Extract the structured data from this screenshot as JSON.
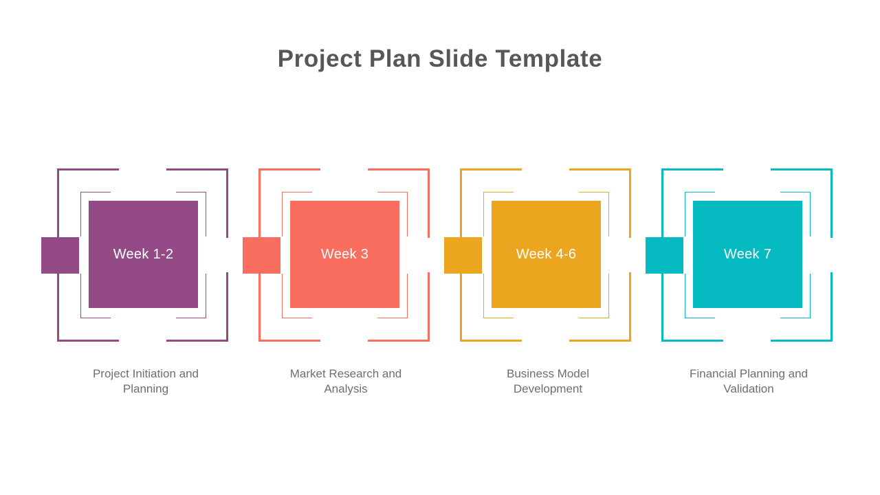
{
  "slide": {
    "title": "Project Plan Slide Template",
    "background_color": "#ffffff",
    "title_color": "#575757",
    "caption_color": "#6e6e6e"
  },
  "steps": [
    {
      "week_label": "Week 1-2",
      "caption": "Project Initiation and\nPlanning",
      "color": "#954a88"
    },
    {
      "week_label": "Week 3",
      "caption": "Market Research and\nAnalysis",
      "color": "#fa6e5f"
    },
    {
      "week_label": "Week 4-6",
      "caption": "Business Model\nDevelopment",
      "color": "#eca51f"
    },
    {
      "week_label": "Week 7",
      "caption": "Financial Planning and\nValidation",
      "color": "#06bac2"
    }
  ]
}
